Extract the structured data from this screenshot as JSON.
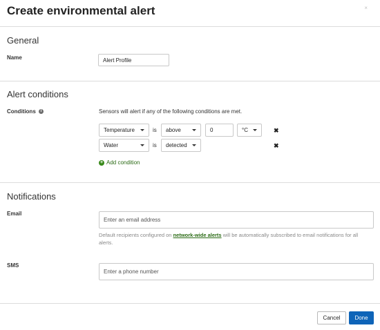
{
  "dialog": {
    "title": "Create environmental alert",
    "close_icon": "×"
  },
  "general": {
    "heading": "General",
    "name_label": "Name",
    "name_value": "Alert Profile"
  },
  "conditions": {
    "heading": "Alert conditions",
    "label": "Conditions",
    "info_icon": "i",
    "intro": "Sensors will alert if any of the following conditions are met.",
    "rows": [
      {
        "metric": "Temperature",
        "is": "is",
        "operator": "above",
        "value": "0",
        "unit": "°C"
      },
      {
        "metric": "Water",
        "is": "is",
        "operator": "detected"
      }
    ],
    "remove_icon": "✖",
    "add_label": "Add condition",
    "add_icon": "+"
  },
  "notifications": {
    "heading": "Notifications",
    "email_label": "Email",
    "email_placeholder": "Enter an email address",
    "helper_prefix": "Default recipients configured on ",
    "helper_link": "network-wide alerts",
    "helper_suffix": " will be automatically subscribed to email notifications for all alerts.",
    "sms_label": "SMS",
    "sms_placeholder": "Enter a phone number"
  },
  "footer": {
    "cancel_label": "Cancel",
    "done_label": "Done"
  },
  "colors": {
    "primary": "#0e64b8",
    "link": "#2a6a14",
    "add": "#3a8a1c"
  }
}
